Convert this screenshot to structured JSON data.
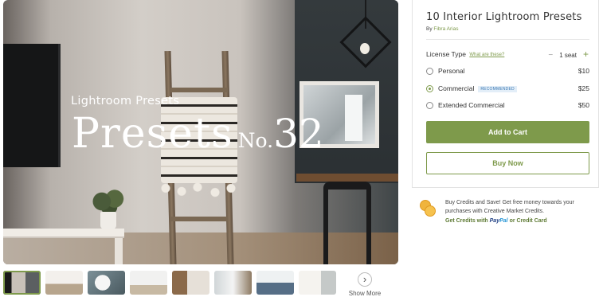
{
  "hero": {
    "overline": "Lightroom Presets",
    "headline_big": "Presets",
    "headline_no": "No.",
    "headline_num": "32"
  },
  "thumbnails": [
    {
      "icon": "preview-thumbnail",
      "selected": true
    },
    {
      "icon": "preview-thumbnail",
      "selected": false
    },
    {
      "icon": "preview-thumbnail",
      "selected": false
    },
    {
      "icon": "preview-thumbnail",
      "selected": false
    },
    {
      "icon": "preview-thumbnail",
      "selected": false
    },
    {
      "icon": "preview-thumbnail",
      "selected": false
    },
    {
      "icon": "preview-thumbnail",
      "selected": false
    },
    {
      "icon": "preview-thumbnail",
      "selected": false
    }
  ],
  "show_more": {
    "label": "Show More",
    "icon": "chevron-right-icon",
    "glyph": "›"
  },
  "product": {
    "title": "10 Interior Lightroom Presets",
    "by_prefix": "By",
    "author": "Fibra Arias"
  },
  "license": {
    "label": "License Type",
    "help_link": "What are these?",
    "seat_minus": "−",
    "seat_value": "1 seat",
    "seat_plus": "+",
    "options": [
      {
        "name": "Personal",
        "price": "$10",
        "selected": false,
        "badge": ""
      },
      {
        "name": "Commercial",
        "price": "$25",
        "selected": true,
        "badge": "RECOMMENDED"
      },
      {
        "name": "Extended Commercial",
        "price": "$50",
        "selected": false,
        "badge": ""
      }
    ]
  },
  "actions": {
    "add_to_cart": "Add to Cart",
    "buy_now": "Buy Now"
  },
  "credits": {
    "text": "Buy Credits and Save! Get free money towards your purchases with Creative Market Credits.",
    "pay_prefix": "Get Credits with",
    "paypal_1": "Pay",
    "paypal_2": "Pal",
    "pay_suffix": "or Credit Card"
  },
  "colors": {
    "accent": "#7e9a4b",
    "badge_bg": "#e3eef8",
    "badge_text": "#3a78b3"
  }
}
